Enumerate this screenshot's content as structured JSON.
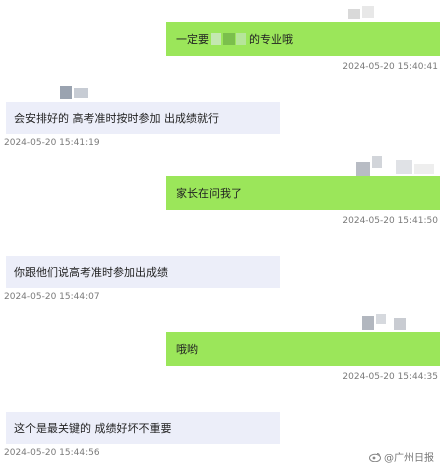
{
  "messages": [
    {
      "side": "sent",
      "text_pre": "一定要",
      "text_post": "的专业哦",
      "time": "2024-05-20 15:40:41"
    },
    {
      "side": "recv",
      "text": "会安排好的 高考准时按时参加 出成绩就行",
      "time": "2024-05-20 15:41:19"
    },
    {
      "side": "sent",
      "text": "家长在问我了",
      "time": "2024-05-20 15:41:50"
    },
    {
      "side": "recv",
      "text": "你跟他们说高考准时参加出成绩",
      "time": "2024-05-20 15:44:07"
    },
    {
      "side": "sent",
      "text": "哦哟",
      "time": "2024-05-20 15:44:35"
    },
    {
      "side": "recv",
      "text": "这个是最关键的 成绩好坏不重要",
      "time": "2024-05-20 15:44:56"
    }
  ],
  "watermark": "@广州日报",
  "colors": {
    "sent": "#9be65a",
    "recv": "#eceef9",
    "timestamp": "#7a7a7a"
  }
}
